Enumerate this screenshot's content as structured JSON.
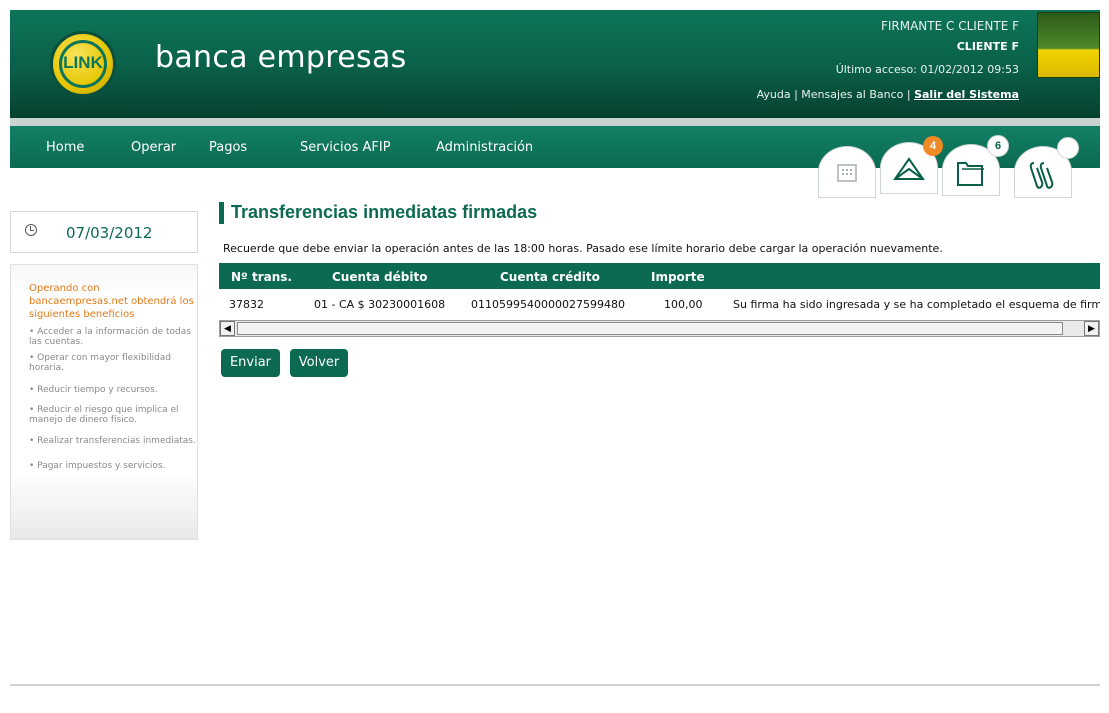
{
  "header": {
    "logo_text": "LINK",
    "brand": "banca empresas",
    "user_name": "FIRMANTE C CLIENTE F",
    "company": "CLIENTE F",
    "last_access": "Último acceso: 01/02/2012 09:53",
    "links": {
      "help": "Ayuda",
      "sep1": " | ",
      "messages": "Mensajes al Banco",
      "sep2": " | ",
      "logout": "Salir del Sistema"
    }
  },
  "nav": {
    "items": [
      "Home",
      "Operar",
      "Pagos",
      "Servicios AFIP",
      "Administración"
    ],
    "tools": [
      {
        "icon": "calendar-icon",
        "badge": ""
      },
      {
        "icon": "envelope-icon",
        "badge": "4",
        "badge_color": "#f08a24"
      },
      {
        "icon": "folder-icon",
        "badge": "6",
        "badge_color": "#ffffff"
      },
      {
        "icon": "paperclip-icon",
        "badge": "",
        "badge_color": "#ffffff"
      }
    ]
  },
  "sidebar": {
    "date": "07/03/2012",
    "benefits_title": "Operando con bancaempresas.net obtendrá los siguientes beneficios",
    "benefits": [
      "• Acceder a la información de todas las cuentas.",
      "• Operar con mayor flexibilidad horaria.",
      "• Reducir tiempo y recursos.",
      "• Reducir el riesgo que implica el manejo de dinero físico.",
      "• Realizar transferencias inmediatas.",
      "• Pagar impuestos y servicios."
    ]
  },
  "main": {
    "title": "Transferencias inmediatas firmadas",
    "notice": "Recuerde que debe enviar la operación antes de las 18:00 horas. Pasado ese límite horario debe cargar la operación nuevamente.",
    "table": {
      "headers": [
        "Nº trans.",
        "Cuenta débito",
        "Cuenta crédito",
        "Importe"
      ],
      "rows": [
        [
          "37832",
          "01 - CA $ 30230001608",
          "0110599540000027599480",
          "100,00",
          "Su firma ha sido ingresada y se ha completado el esquema de firmas"
        ]
      ]
    },
    "buttons": {
      "send": "Enviar",
      "back": "Volver"
    }
  },
  "colors": {
    "primary": "#0b6a51",
    "accent_orange": "#e07a1a",
    "badge_orange": "#f08a24"
  }
}
